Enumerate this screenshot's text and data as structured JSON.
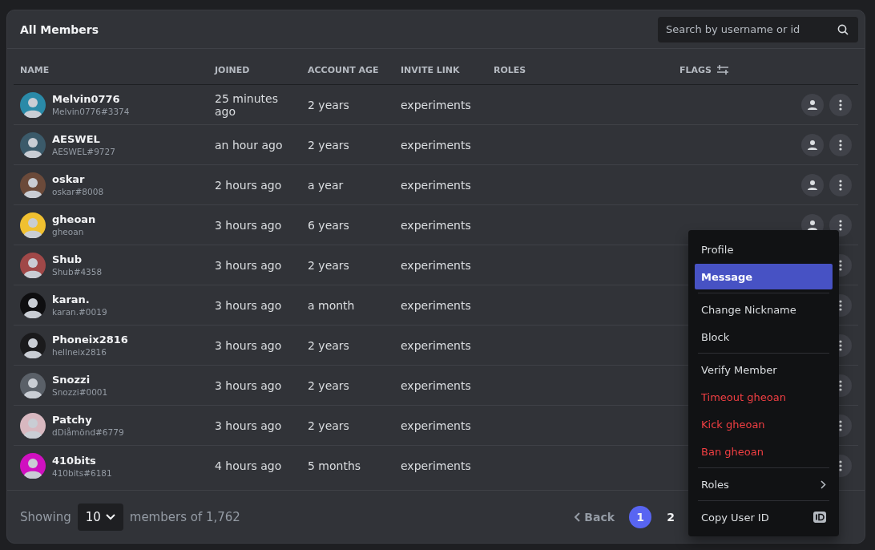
{
  "title": "All Members",
  "search": {
    "placeholder": "Search by username or id"
  },
  "columns": [
    {
      "label": "NAME",
      "kind": "plain"
    },
    {
      "label": "JOINED",
      "kind": "plain"
    },
    {
      "label": "ACCOUNT AGE",
      "kind": "plain"
    },
    {
      "label": "INVITE LINK",
      "kind": "plain"
    },
    {
      "label": "ROLES",
      "kind": "plain"
    },
    {
      "label": "FLAGS",
      "kind": "filter"
    }
  ],
  "rows": [
    {
      "name": "Melvin0776",
      "tag": "Melvin0776#3374",
      "joined": "25 minutes ago",
      "account_age": "2 years",
      "invite_link": "experiments",
      "menu_open": false
    },
    {
      "name": "AESWEL",
      "tag": "AESWEL#9727",
      "joined": "an hour ago",
      "account_age": "2 years",
      "invite_link": "experiments",
      "menu_open": false
    },
    {
      "name": "oskar",
      "tag": "oskar#8008",
      "joined": "2 hours ago",
      "account_age": "a year",
      "invite_link": "experiments",
      "menu_open": false
    },
    {
      "name": "gheoan",
      "tag": "gheoan",
      "joined": "3 hours ago",
      "account_age": "6 years",
      "invite_link": "experiments",
      "menu_open": true
    },
    {
      "name": "Shub",
      "tag": "Shub#4358",
      "joined": "3 hours ago",
      "account_age": "2 years",
      "invite_link": "experiments",
      "menu_open": false
    },
    {
      "name": "karan.",
      "tag": "karan.#0019",
      "joined": "3 hours ago",
      "account_age": "a month",
      "invite_link": "experiments",
      "menu_open": false
    },
    {
      "name": "Phoneix2816",
      "tag": "hellneix2816",
      "joined": "3 hours ago",
      "account_age": "2 years",
      "invite_link": "experiments",
      "menu_open": false
    },
    {
      "name": "Snozzi",
      "tag": "Snozzi#0001",
      "joined": "3 hours ago",
      "account_age": "2 years",
      "invite_link": "experiments",
      "menu_open": false
    },
    {
      "name": "Patchy",
      "tag": "dDiåmönd#6779",
      "joined": "3 hours ago",
      "account_age": "2 years",
      "invite_link": "experiments",
      "menu_open": false
    },
    {
      "name": "410bits",
      "tag": "410bits#6181",
      "joined": "4 hours ago",
      "account_age": "5 months",
      "invite_link": "experiments",
      "menu_open": false
    }
  ],
  "footer": {
    "showing": "Showing",
    "page_size": "10",
    "suffix": "members of 1,762",
    "back": "Back",
    "pages": [
      {
        "label": "1",
        "selected": true
      },
      {
        "label": "2",
        "selected": false
      }
    ]
  },
  "menu": {
    "groups": [
      [
        {
          "label": "Profile",
          "kind": "item",
          "selected": false
        },
        {
          "label": "Message",
          "kind": "item",
          "selected": true
        }
      ],
      [
        {
          "label": "Change Nickname",
          "kind": "item",
          "selected": false
        },
        {
          "label": "Block",
          "kind": "item",
          "selected": false
        }
      ],
      [
        {
          "label": "Verify Member",
          "kind": "item",
          "selected": false
        },
        {
          "label": "Timeout gheoan",
          "kind": "danger",
          "selected": false
        },
        {
          "label": "Kick gheoan",
          "kind": "danger",
          "selected": false
        },
        {
          "label": "Ban gheoan",
          "kind": "danger",
          "selected": false
        }
      ],
      [
        {
          "label": "Roles",
          "kind": "submenu",
          "selected": false
        }
      ],
      [
        {
          "label": "Copy User ID",
          "kind": "id",
          "selected": false
        }
      ]
    ]
  }
}
